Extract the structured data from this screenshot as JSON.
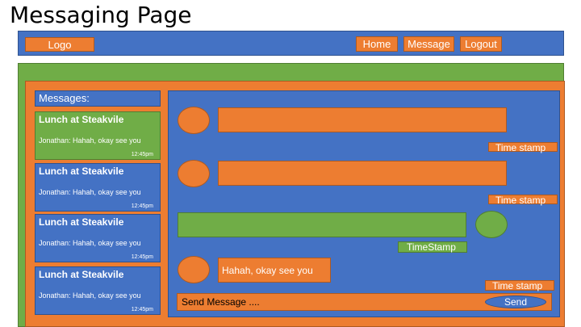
{
  "page_title": "Messaging Page",
  "nav": {
    "logo": "Logo",
    "home": "Home",
    "message": "Message",
    "logout": "Logout"
  },
  "sidebar": {
    "header": "Messages:",
    "conversations": [
      {
        "title": "Lunch at Steakvile",
        "preview": "Jonathan: Hahah, okay see you",
        "time": "12:45pm",
        "selected": true
      },
      {
        "title": "Lunch at Steakvile",
        "preview": "Jonathan: Hahah, okay see you",
        "time": "12:45pm",
        "selected": false
      },
      {
        "title": "Lunch at Steakvile",
        "preview": "Jonathan: Hahah, okay see you",
        "time": "12:45pm",
        "selected": false
      },
      {
        "title": "Lunch at Steakvile",
        "preview": "Jonathan: Hahah, okay see you",
        "time": "12:45pm",
        "selected": false
      }
    ]
  },
  "chat": {
    "messages": [
      {
        "side": "left",
        "text": "",
        "timestamp": "Time stamp"
      },
      {
        "side": "left",
        "text": "",
        "timestamp": "Time stamp"
      },
      {
        "side": "right",
        "text": "",
        "timestamp": "TimeStamp"
      },
      {
        "side": "left",
        "text": "Hahah, okay see you",
        "timestamp": "Time stamp"
      }
    ],
    "input_placeholder": "Send Message ....",
    "send_label": "Send"
  },
  "colors": {
    "blue": "#4472c4",
    "orange": "#ed7d31",
    "green": "#70ad47"
  }
}
